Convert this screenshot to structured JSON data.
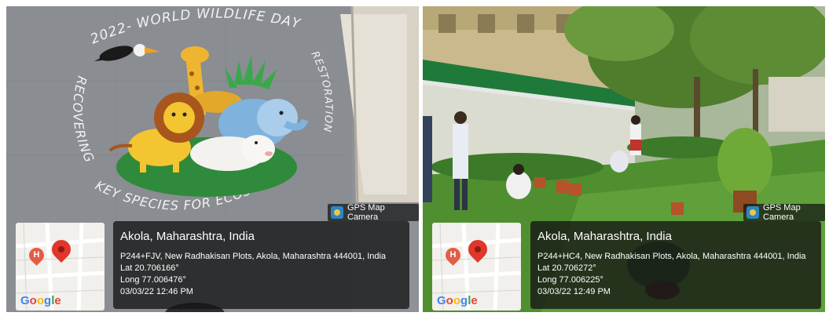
{
  "panels": [
    {
      "id": "left",
      "rangoli_text": {
        "top": "2022- WORLD WILDLIFE DAY",
        "left": "RECOVERING",
        "bottom": "KEY SPECIES FOR ECOSYSTEM",
        "right": "RESTORATION"
      },
      "gps_tag": "GPS Map Camera",
      "location_title": "Akola, Maharashtra, India",
      "address": "P244+FJV, New Radhakisan Plots, Akola, Maharashtra 444001, India",
      "lat": "Lat 20.706166°",
      "long": "Long 77.006476°",
      "datetime": "03/03/22 12:46 PM"
    },
    {
      "id": "right",
      "gps_tag": "GPS Map Camera",
      "location_title": "Akola, Maharashtra, India",
      "address": "P244+HC4, New Radhakisan Plots, Akola, Maharashtra 444001, India",
      "lat": "Lat 20.706272°",
      "long": "Long 77.006225°",
      "datetime": "03/03/22 12:49 PM"
    }
  ],
  "map": {
    "marker_letter": "H",
    "logo": [
      "G",
      "o",
      "o",
      "g",
      "l",
      "e"
    ],
    "logo_colors": [
      "#4285F4",
      "#EA4335",
      "#FBBC05",
      "#4285F4",
      "#34A853",
      "#EA4335"
    ]
  },
  "icons": [
    "gps-map-camera-icon",
    "location-pin-icon",
    "hospital-marker-icon"
  ]
}
